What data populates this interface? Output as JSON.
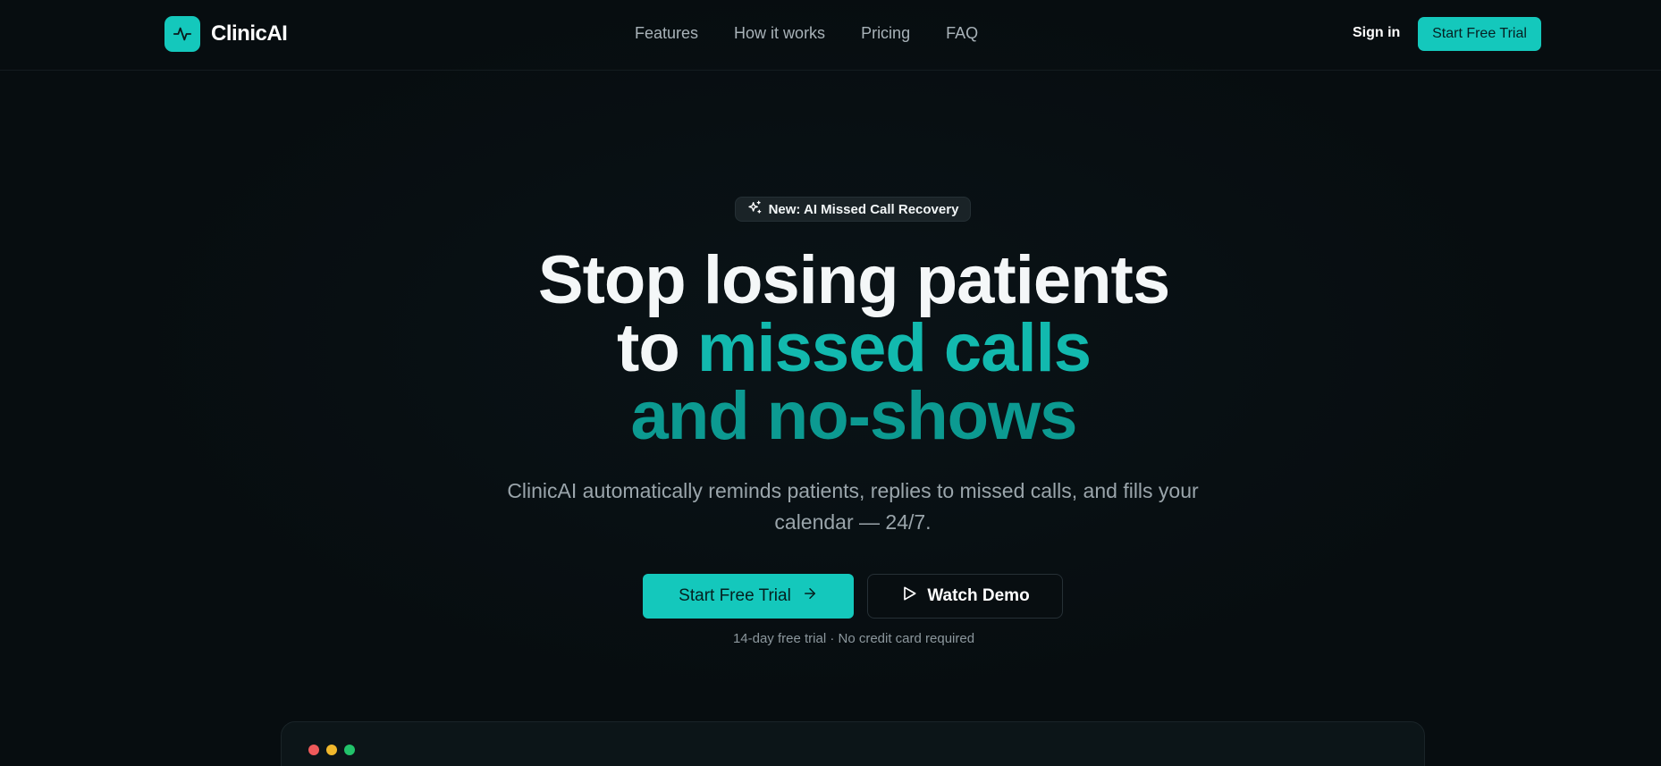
{
  "nav": {
    "brand": "ClinicAI",
    "links": [
      "Features",
      "How it works",
      "Pricing",
      "FAQ"
    ],
    "sign_in": "Sign in",
    "cta": "Start Free Trial"
  },
  "hero": {
    "badge": "New: AI Missed Call Recovery",
    "headline_line1": "Stop losing patients",
    "headline_line2_white": "to ",
    "headline_line2_teal": "missed calls",
    "headline_line3": "and no-shows",
    "subtext": "ClinicAI automatically reminds patients, replies to missed calls, and fills your calendar — 24/7.",
    "cta_primary": "Start Free Trial",
    "cta_secondary": "Watch Demo",
    "note": "14-day free trial · No credit card required"
  },
  "icons": {
    "logo": "pulse-icon",
    "badge": "sparkles-icon",
    "cta_primary": "arrow-right-icon",
    "cta_secondary": "play-icon"
  },
  "colors": {
    "accent": "#14c8bc",
    "background": "#070d10",
    "window_dots": [
      "#ef5a5a",
      "#f1b82c",
      "#22c36a"
    ]
  }
}
